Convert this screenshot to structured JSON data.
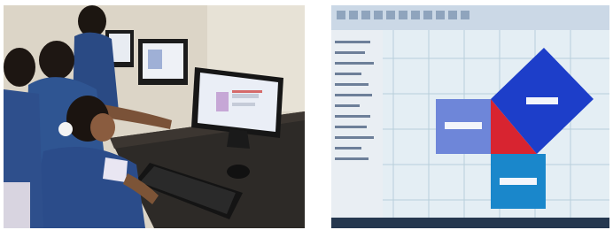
{
  "photos": [
    {
      "subject": "students-using-desktop-computers",
      "colors": {
        "wall": "#ddd6c8",
        "uniform": "#2c4c86",
        "desk": "#2e2a26",
        "monitor": "#1b1b1b",
        "screen": "#e9edf5"
      }
    },
    {
      "subject": "geometry-software-pythagorean-squares",
      "colors": {
        "canvas": "#e6f0f5",
        "grid": "#b9d0dc",
        "diamond": "#1e3fc8",
        "triangle": "#d9242d",
        "left_square": "#6f86d8",
        "bottom_square": "#1a86c9",
        "toolbar": "#c9d7e6"
      },
      "shape_labels": [
        "",
        "",
        ""
      ]
    }
  ]
}
